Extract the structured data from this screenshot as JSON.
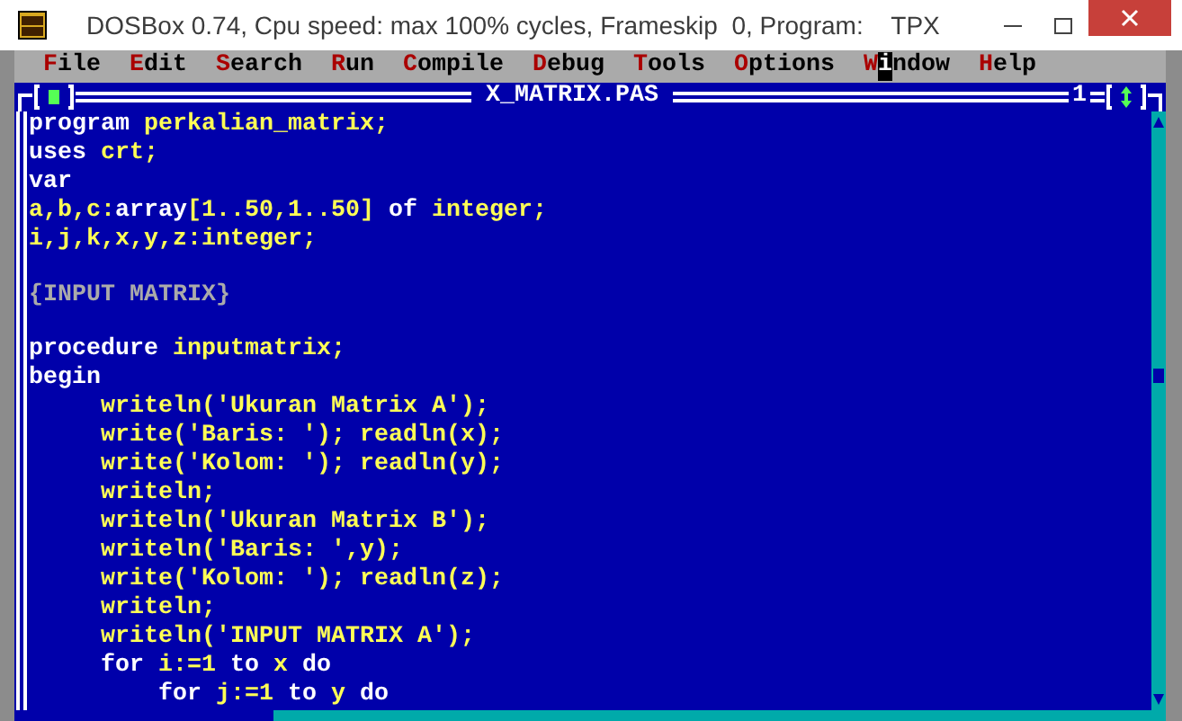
{
  "window": {
    "title": "DOSBox 0.74, Cpu speed: max 100% cycles, Frameskip  0, Program:    TPX"
  },
  "menu": [
    {
      "parts": [
        {
          "text": "F",
          "kind": "hotkey"
        },
        {
          "text": "ile",
          "kind": "plain"
        }
      ]
    },
    {
      "parts": [
        {
          "text": "E",
          "kind": "hotkey"
        },
        {
          "text": "dit",
          "kind": "plain"
        }
      ]
    },
    {
      "parts": [
        {
          "text": "S",
          "kind": "hotkey"
        },
        {
          "text": "earch",
          "kind": "plain"
        }
      ]
    },
    {
      "parts": [
        {
          "text": "R",
          "kind": "hotkey"
        },
        {
          "text": "un",
          "kind": "plain"
        }
      ]
    },
    {
      "parts": [
        {
          "text": "C",
          "kind": "hotkey"
        },
        {
          "text": "ompile",
          "kind": "plain"
        }
      ]
    },
    {
      "parts": [
        {
          "text": "D",
          "kind": "hotkey"
        },
        {
          "text": "ebug",
          "kind": "plain"
        }
      ]
    },
    {
      "parts": [
        {
          "text": "T",
          "kind": "hotkey"
        },
        {
          "text": "ools",
          "kind": "plain"
        }
      ]
    },
    {
      "parts": [
        {
          "text": "O",
          "kind": "hotkey"
        },
        {
          "text": "ptions",
          "kind": "plain"
        }
      ]
    },
    {
      "parts": [
        {
          "text": "W",
          "kind": "hotkey"
        },
        {
          "text": "i",
          "kind": "cursor"
        },
        {
          "text": "ndow",
          "kind": "plain"
        }
      ]
    },
    {
      "parts": [
        {
          "text": "H",
          "kind": "hotkey"
        },
        {
          "text": "elp",
          "kind": "plain"
        }
      ]
    }
  ],
  "editor": {
    "title": "X_MATRIX.PAS",
    "window_number": "1",
    "lines": [
      [
        {
          "text": "program ",
          "kind": "keyword"
        },
        {
          "text": "perkalian_matrix;",
          "kind": "ident"
        }
      ],
      [
        {
          "text": "uses ",
          "kind": "keyword"
        },
        {
          "text": "crt;",
          "kind": "ident"
        }
      ],
      [
        {
          "text": "var",
          "kind": "keyword"
        }
      ],
      [
        {
          "text": "a,b,c:",
          "kind": "ident"
        },
        {
          "text": "array",
          "kind": "keyword"
        },
        {
          "text": "[1..50,1..50] ",
          "kind": "ident"
        },
        {
          "text": "of",
          "kind": "keyword"
        },
        {
          "text": " integer;",
          "kind": "ident"
        }
      ],
      [
        {
          "text": "i,j,k,x,y,z:integer;",
          "kind": "ident"
        }
      ],
      {
        "kind": "blank"
      },
      [
        {
          "text": "{INPUT MATRIX}",
          "kind": "comment"
        }
      ],
      {
        "kind": "blank"
      },
      [
        {
          "text": "procedure ",
          "kind": "keyword"
        },
        {
          "text": "inputmatrix;",
          "kind": "ident"
        }
      ],
      [
        {
          "text": "begin",
          "kind": "keyword"
        }
      ],
      [
        {
          "text": "     writeln('Ukuran Matrix A');",
          "kind": "ident"
        }
      ],
      [
        {
          "text": "     write('Baris: '); readln(x);",
          "kind": "ident"
        }
      ],
      [
        {
          "text": "     write('Kolom: '); readln(y);",
          "kind": "ident"
        }
      ],
      [
        {
          "text": "     writeln;",
          "kind": "ident"
        }
      ],
      [
        {
          "text": "     writeln('Ukuran Matrix B');",
          "kind": "ident"
        }
      ],
      [
        {
          "text": "     writeln('Baris: ',y);",
          "kind": "ident"
        }
      ],
      [
        {
          "text": "     write('Kolom: '); readln(z);",
          "kind": "ident"
        }
      ],
      [
        {
          "text": "     writeln;",
          "kind": "ident"
        }
      ],
      [
        {
          "text": "     writeln('INPUT MATRIX A');",
          "kind": "ident"
        }
      ],
      [
        {
          "text": "     for ",
          "kind": "keyword"
        },
        {
          "text": "i:=1 ",
          "kind": "ident"
        },
        {
          "text": "to",
          "kind": "keyword"
        },
        {
          "text": " x ",
          "kind": "ident"
        },
        {
          "text": "do",
          "kind": "keyword"
        }
      ],
      [
        {
          "text": "         for ",
          "kind": "keyword"
        },
        {
          "text": "j:=1 ",
          "kind": "ident"
        },
        {
          "text": "to",
          "kind": "keyword"
        },
        {
          "text": " y ",
          "kind": "ident"
        },
        {
          "text": "do",
          "kind": "keyword"
        }
      ]
    ]
  }
}
